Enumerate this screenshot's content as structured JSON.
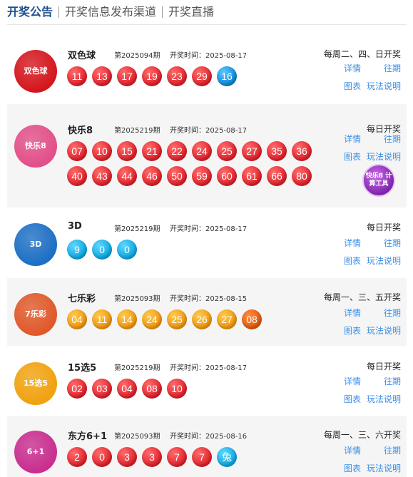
{
  "tabs": [
    "开奖公告",
    "开奖信息发布渠道",
    "开奖直播"
  ],
  "links": {
    "detail": "详情",
    "past": "往期",
    "chart": "图表",
    "rules": "玩法说明"
  },
  "lotteries": [
    {
      "name": "双色球",
      "issue": "第2025094期",
      "date": "开奖时间：2025-08-17",
      "schedule": "每周二、四、日开奖",
      "logo_text": "双色球",
      "logo_color": "#d4161d",
      "balls": [
        {
          "n": "11",
          "c": "red"
        },
        {
          "n": "13",
          "c": "red"
        },
        {
          "n": "17",
          "c": "red"
        },
        {
          "n": "19",
          "c": "red"
        },
        {
          "n": "23",
          "c": "red"
        },
        {
          "n": "29",
          "c": "red"
        },
        {
          "n": "16",
          "c": "blue"
        }
      ]
    },
    {
      "name": "快乐8",
      "issue": "第2025219期",
      "date": "开奖时间：2025-08-17",
      "schedule": "每日开奖",
      "logo_text": "快乐8",
      "logo_color": "#e24f8a",
      "tool_label": "快乐8 计算工具",
      "balls": [
        {
          "n": "07",
          "c": "red"
        },
        {
          "n": "10",
          "c": "red"
        },
        {
          "n": "15",
          "c": "red"
        },
        {
          "n": "21",
          "c": "red"
        },
        {
          "n": "22",
          "c": "red"
        },
        {
          "n": "24",
          "c": "red"
        },
        {
          "n": "25",
          "c": "red"
        },
        {
          "n": "27",
          "c": "red"
        },
        {
          "n": "35",
          "c": "red"
        },
        {
          "n": "36",
          "c": "red"
        },
        {
          "n": "40",
          "c": "red"
        },
        {
          "n": "43",
          "c": "red"
        },
        {
          "n": "44",
          "c": "red"
        },
        {
          "n": "46",
          "c": "red"
        },
        {
          "n": "50",
          "c": "red"
        },
        {
          "n": "59",
          "c": "red"
        },
        {
          "n": "60",
          "c": "red"
        },
        {
          "n": "61",
          "c": "red"
        },
        {
          "n": "66",
          "c": "red"
        },
        {
          "n": "80",
          "c": "red"
        }
      ]
    },
    {
      "name": "3D",
      "issue": "第2025219期",
      "date": "开奖时间：2025-08-17",
      "schedule": "每日开奖",
      "logo_text": "3D",
      "logo_color": "#1d6fc4",
      "balls": [
        {
          "n": "9",
          "c": "cyan"
        },
        {
          "n": "0",
          "c": "cyan"
        },
        {
          "n": "0",
          "c": "cyan"
        }
      ]
    },
    {
      "name": "七乐彩",
      "issue": "第2025093期",
      "date": "开奖时间：2025-08-15",
      "schedule": "每周一、三、五开奖",
      "logo_text": "7乐彩",
      "logo_color": "#e0592a",
      "balls": [
        {
          "n": "04",
          "c": "orange"
        },
        {
          "n": "11",
          "c": "orange"
        },
        {
          "n": "14",
          "c": "orange"
        },
        {
          "n": "24",
          "c": "orange"
        },
        {
          "n": "25",
          "c": "orange"
        },
        {
          "n": "26",
          "c": "orange"
        },
        {
          "n": "27",
          "c": "orange"
        },
        {
          "n": "08",
          "c": "deep"
        }
      ]
    },
    {
      "name": "15选5",
      "issue": "第2025219期",
      "date": "开奖时间：2025-08-17",
      "schedule": "每日开奖",
      "logo_text": "15选5",
      "logo_color": "#f0a20f",
      "balls": [
        {
          "n": "02",
          "c": "red"
        },
        {
          "n": "03",
          "c": "red"
        },
        {
          "n": "04",
          "c": "red"
        },
        {
          "n": "08",
          "c": "red"
        },
        {
          "n": "10",
          "c": "red"
        }
      ]
    },
    {
      "name": "东方6+1",
      "issue": "第2025093期",
      "date": "开奖时间：2025-08-16",
      "schedule": "每周一、三、六开奖",
      "logo_text": "6+1",
      "logo_color": "#c92e8f",
      "balls": [
        {
          "n": "2",
          "c": "red"
        },
        {
          "n": "0",
          "c": "red"
        },
        {
          "n": "3",
          "c": "red"
        },
        {
          "n": "3",
          "c": "red"
        },
        {
          "n": "7",
          "c": "red"
        },
        {
          "n": "7",
          "c": "red"
        },
        {
          "n": "兔",
          "c": "cyan"
        }
      ]
    }
  ]
}
